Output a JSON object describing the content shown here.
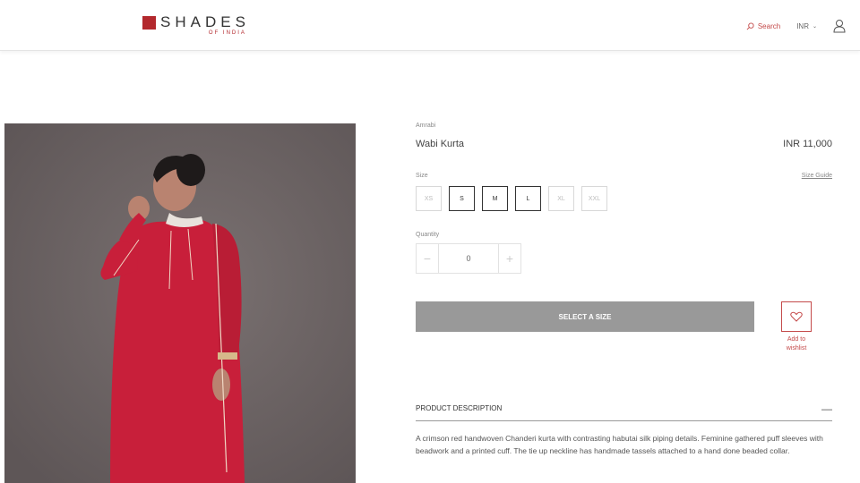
{
  "header": {
    "logo_main": "SHADES",
    "logo_sub": "OF INDIA",
    "search_label": "Search",
    "currency_label": "INR",
    "brand_color": "#b3282d"
  },
  "product": {
    "image_alt": "Woman wearing crimson red kurta",
    "brand": "Amrabi",
    "title": "Wabi Kurta",
    "price": "INR 11,000",
    "size_label": "Size",
    "size_guide": "Size Guide",
    "sizes": [
      {
        "label": "XS",
        "available": false
      },
      {
        "label": "S",
        "available": true
      },
      {
        "label": "M",
        "available": true
      },
      {
        "label": "L",
        "available": true
      },
      {
        "label": "XL",
        "available": false
      },
      {
        "label": "XXL",
        "available": false
      }
    ],
    "quantity_label": "Quantity",
    "quantity_value": "0",
    "select_size_button": "SELECT A SIZE",
    "wishlist_label": "Add to wishlist",
    "description_title": "PRODUCT DESCRIPTION",
    "description_toggle": "—",
    "description_text": "A crimson red handwoven Chanderi kurta with contrasting habutai silk piping details. Feminine gathered puff sleeves with beadwork and a printed cuff. The tie up neckline has handmade tassels attached to a hand done beaded collar."
  }
}
